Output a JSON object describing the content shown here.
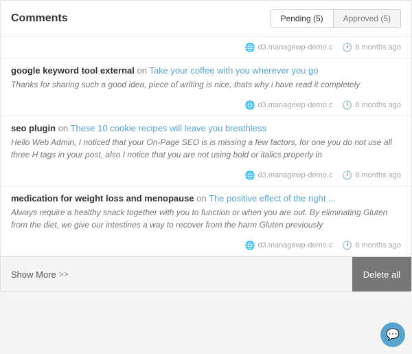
{
  "header": {
    "title": "Comments",
    "tabs": [
      {
        "label": "Pending (5)",
        "active": true
      },
      {
        "label": "Approved (5)",
        "active": false
      }
    ]
  },
  "top_meta": {
    "domain": "d3.managewp-demo.c",
    "time": "8 months ago"
  },
  "comments": [
    {
      "author": "google keyword tool external",
      "on_text": "on",
      "link_text": "Take your coffee with you wherever you go",
      "body": "Thanks for sharing such a good idea, piece of writing is nice, thats why i have read it completely",
      "domain": "d3.managewp-demo.c",
      "time": "8 months ago"
    },
    {
      "author": "seo plugin",
      "on_text": "on",
      "link_text": "These 10 cookie recipes will leave you breathless",
      "body": "Hello Web Admin, I noticed that your On-Page SEO is is missing a few factors, for one you do not use all three H tags in your post, also I notice that you are not using bold or italics properly in",
      "domain": "d3.managewp-demo.c",
      "time": "8 months ago"
    },
    {
      "author": "medication for weight loss and menopause",
      "on_text": "on",
      "link_text": "The positive effect of the right ...",
      "body": "Always require a healthy snack together with you to function or when you are out. By eliminating Gluten from the diet, we give our intestines a way to recover from the harm Gluten previously",
      "domain": "d3.managewp-demo.c",
      "time": "8 months ago"
    }
  ],
  "footer": {
    "show_more_label": "Show More",
    "show_more_arrows": ">>",
    "delete_all_label": "Delete all"
  },
  "chat_icon": "💬"
}
